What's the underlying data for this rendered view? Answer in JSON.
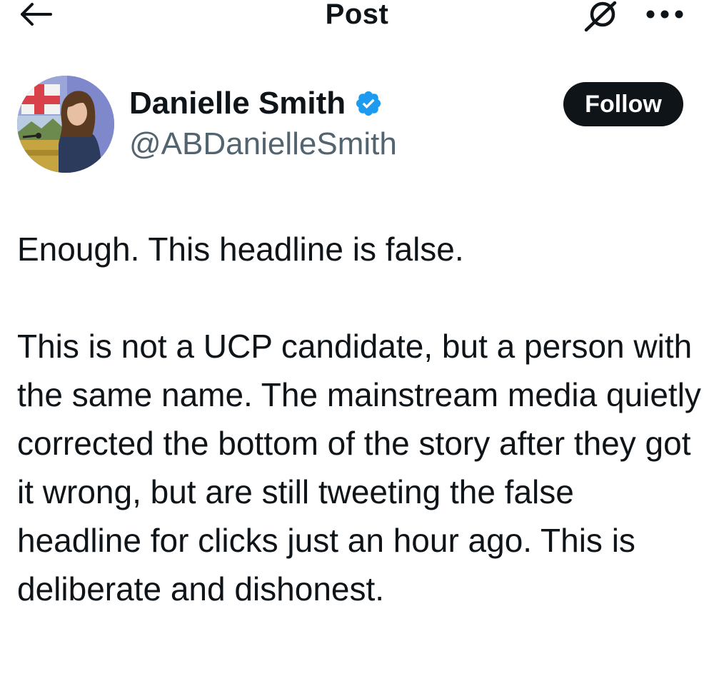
{
  "header": {
    "title": "Post",
    "back_icon": "arrow-left-icon",
    "grok_icon": "grok-icon",
    "more_icon": "more-horizontal-icon"
  },
  "author": {
    "display_name": "Danielle Smith",
    "handle": "@ABDanielleSmith",
    "verified": true,
    "verified_color": "#1d9bf0",
    "avatar_icon": "profile-photo"
  },
  "follow_button": {
    "label": "Follow"
  },
  "post": {
    "paragraphs": [
      "Enough. This headline is false.",
      "This is not a UCP candidate, but a person with the same name. The mainstream media quietly corrected the bottom of the story after they got it wrong, but are still tweeting the false headline for clicks just an hour ago. This is deliberate and dishonest."
    ]
  },
  "colors": {
    "text": "#0f1419",
    "secondary_text": "#536471",
    "follow_bg": "#0f1419",
    "follow_text": "#ffffff",
    "background": "#ffffff"
  }
}
